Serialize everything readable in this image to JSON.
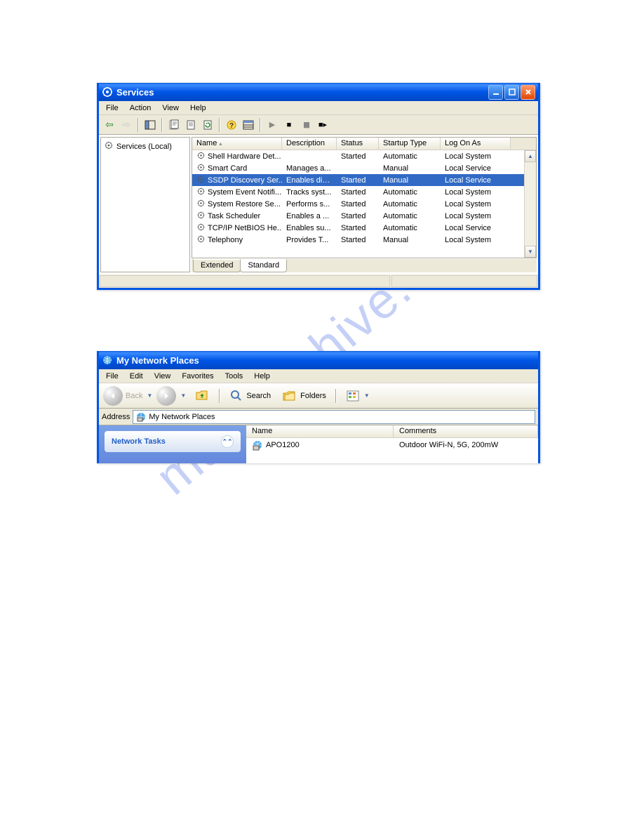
{
  "watermark": "manualshive.com",
  "services_window": {
    "title": "Services",
    "menu": [
      "File",
      "Action",
      "View",
      "Help"
    ],
    "tree_root": "Services (Local)",
    "columns": [
      "Name",
      "Description",
      "Status",
      "Startup Type",
      "Log On As"
    ],
    "rows": [
      {
        "name": "Shell Hardware Det...",
        "desc": "",
        "status": "Started",
        "startup": "Automatic",
        "logon": "Local System",
        "selected": false
      },
      {
        "name": "Smart Card",
        "desc": "Manages a...",
        "status": "",
        "startup": "Manual",
        "logon": "Local Service",
        "selected": false
      },
      {
        "name": "SSDP Discovery Ser...",
        "desc": "Enables dis...",
        "status": "Started",
        "startup": "Manual",
        "logon": "Local Service",
        "selected": true
      },
      {
        "name": "System Event Notifi...",
        "desc": "Tracks syst...",
        "status": "Started",
        "startup": "Automatic",
        "logon": "Local System",
        "selected": false
      },
      {
        "name": "System Restore Se...",
        "desc": "Performs s...",
        "status": "Started",
        "startup": "Automatic",
        "logon": "Local System",
        "selected": false
      },
      {
        "name": "Task Scheduler",
        "desc": "Enables a ...",
        "status": "Started",
        "startup": "Automatic",
        "logon": "Local System",
        "selected": false
      },
      {
        "name": "TCP/IP NetBIOS He...",
        "desc": "Enables su...",
        "status": "Started",
        "startup": "Automatic",
        "logon": "Local Service",
        "selected": false
      },
      {
        "name": "Telephony",
        "desc": "Provides T...",
        "status": "Started",
        "startup": "Manual",
        "logon": "Local System",
        "selected": false
      }
    ],
    "tabs": {
      "extended": "Extended",
      "standard": "Standard"
    }
  },
  "network_window": {
    "title": "My Network Places",
    "menu": [
      "File",
      "Edit",
      "View",
      "Favorites",
      "Tools",
      "Help"
    ],
    "toolbar": {
      "back": "Back",
      "search": "Search",
      "folders": "Folders"
    },
    "address_label": "Address",
    "address_value": "My Network Places",
    "tasks_header": "Network Tasks",
    "columns": {
      "name": "Name",
      "comments": "Comments"
    },
    "items": [
      {
        "name": "APO1200",
        "comments": "Outdoor WiFi-N, 5G, 200mW"
      }
    ]
  }
}
